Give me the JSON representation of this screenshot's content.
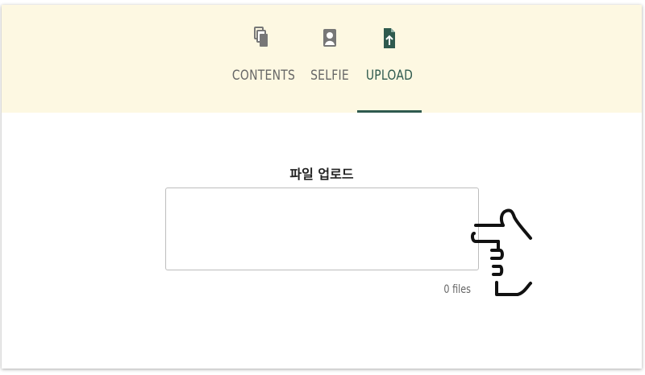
{
  "tabs": {
    "contents": {
      "label": "CONTENTS",
      "icon": "copy-icon"
    },
    "selfie": {
      "label": "SELFIE",
      "icon": "portrait-icon"
    },
    "upload": {
      "label": "UPLOAD",
      "icon": "file-upload-icon",
      "active": true
    }
  },
  "upload": {
    "title": "파일 업로드",
    "file_count": "0 files"
  },
  "colors": {
    "tabbar_bg": "#fdf8e2",
    "accent": "#2f5a4e",
    "inactive_text": "#666666",
    "inactive_icon": "#777777"
  }
}
